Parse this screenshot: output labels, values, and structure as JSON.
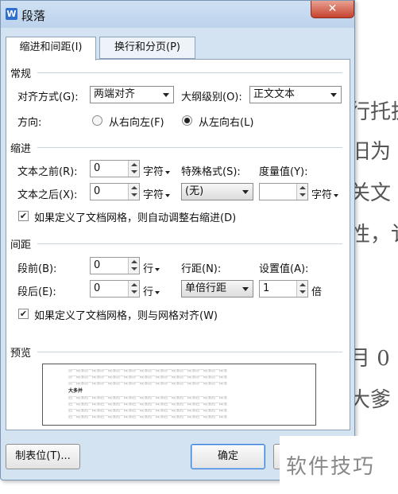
{
  "dialog": {
    "title": "段落",
    "close_label": "✕",
    "app_icon_label": "W",
    "tabs": [
      {
        "label": "缩进和间距(I)",
        "active": true
      },
      {
        "label": "换行和分页(P)",
        "active": false
      }
    ],
    "general": {
      "heading": "常规",
      "alignment_label": "对齐方式(G):",
      "alignment_value": "两端对齐",
      "outline_label": "大纲级别(O):",
      "outline_value": "正文文本",
      "direction_label": "方向:",
      "direction_rtl": "从右向左(F)",
      "direction_ltr": "从左向右(L)",
      "direction_selected": "ltr"
    },
    "indent": {
      "heading": "缩进",
      "before_label": "文本之前(R):",
      "before_value": "0",
      "before_unit": "字符",
      "after_label": "文本之后(X):",
      "after_value": "0",
      "after_unit": "字符",
      "special_label": "特殊格式(S):",
      "special_value": "(无)",
      "measure_label": "度量值(Y):",
      "measure_value": "",
      "measure_unit": "字符",
      "auto_adjust_label": "如果定义了文档网格，则自动调整右缩进(D)",
      "auto_adjust_checked": true
    },
    "spacing": {
      "heading": "间距",
      "before_label": "段前(B):",
      "before_value": "0",
      "before_unit": "行",
      "after_label": "段后(E):",
      "after_value": "0",
      "after_unit": "行",
      "line_spacing_label": "行距(N):",
      "line_spacing_value": "单倍行距",
      "set_value_label": "设置值(A):",
      "set_value": "1",
      "set_value_unit": "倍",
      "snap_grid_label": "如果定义了文档网格，则与网格对齐(W)",
      "snap_grid_checked": true
    },
    "preview": {
      "heading": "预览",
      "sample_line": "前一段落前一段落前一段落前一段落前一段落前一段落前一段落前一段落前一段落前一段落",
      "sample_bold": "大多并",
      "sample_after": "后一段落后一段落后一段落后一段落后一段落后一段落后一段落后一段落后一段落后一段落"
    },
    "buttons": {
      "tabs_label": "制表位(T)...",
      "ok_label": "确定"
    },
    "checkmark": "✔"
  },
  "background": {
    "lines": [
      "行托执",
      "旧为",
      "关文",
      "性，讠",
      "月 0",
      "大爹"
    ],
    "watermark": "软件技巧"
  }
}
